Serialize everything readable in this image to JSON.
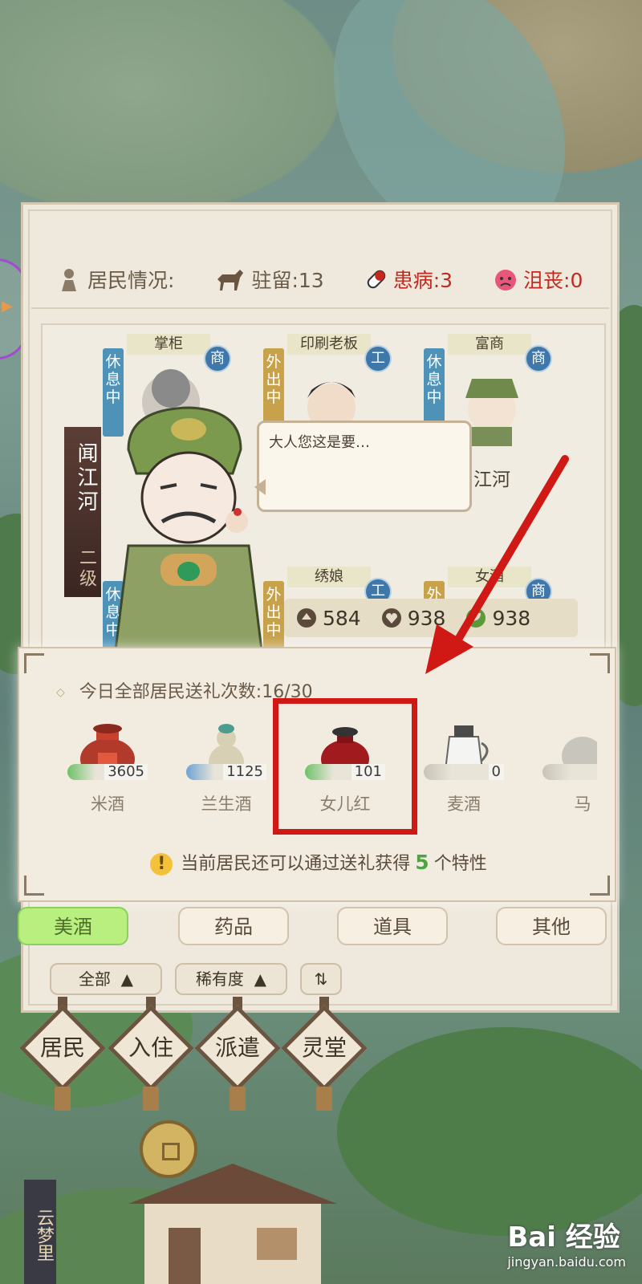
{
  "status": {
    "label": "居民情况:",
    "stay": "驻留:13",
    "sick": "患病:3",
    "depressed": "沮丧:0"
  },
  "residents": [
    {
      "role": "掌柜",
      "state": "休息中",
      "state_color": "#4e92b8",
      "job": "商",
      "name": ""
    },
    {
      "role": "印刷老板",
      "state": "外出中",
      "state_color": "#c7a24b",
      "job": "工",
      "name": ""
    },
    {
      "role": "富商",
      "state": "休息中",
      "state_color": "#4e92b8",
      "job": "商",
      "name": "江河"
    },
    {
      "role": "",
      "state": "休息中",
      "state_color": "#4e92b8",
      "job": "",
      "name": ""
    },
    {
      "role": "绣娘",
      "state": "外出中",
      "state_color": "#c7a24b",
      "job": "工",
      "name": ""
    },
    {
      "role": "女酒",
      "state": "外",
      "state_color": "#c7a24b",
      "job": "商",
      "name": ""
    }
  ],
  "selected": {
    "name": "闻江河",
    "level": "二级",
    "dialog": "大人您这是要…",
    "attr1": "584",
    "attr2": "938",
    "attr3": "938"
  },
  "gift": {
    "count_text": "今日全部居民送礼次数:16/30",
    "items": [
      {
        "name": "米酒",
        "qty": "3605",
        "bar": "green"
      },
      {
        "name": "兰生酒",
        "qty": "1125",
        "bar": "blue"
      },
      {
        "name": "女儿红",
        "qty": "101",
        "bar": "green"
      },
      {
        "name": "麦酒",
        "qty": "0",
        "bar": "gray"
      },
      {
        "name": "马",
        "qty": "",
        "bar": "gray"
      }
    ],
    "hint_prefix": "当前居民还可以通过送礼获得",
    "hint_num": "5",
    "hint_suffix": "个特性"
  },
  "tabs": [
    "美酒",
    "药品",
    "道具",
    "其他"
  ],
  "filters": {
    "all": "全部",
    "rarity": "稀有度",
    "sort": "⇅"
  },
  "nav": [
    "居民",
    "入住",
    "派遣",
    "灵堂"
  ],
  "town": "云梦里",
  "watermark": {
    "main": "Bai 经验",
    "sub": "jingyan.baidu.com"
  },
  "colors": {
    "active_tab": "#b8ef7f",
    "highlight": "#d01914",
    "sick": "#c22a20",
    "hint_num": "#4ea442"
  }
}
